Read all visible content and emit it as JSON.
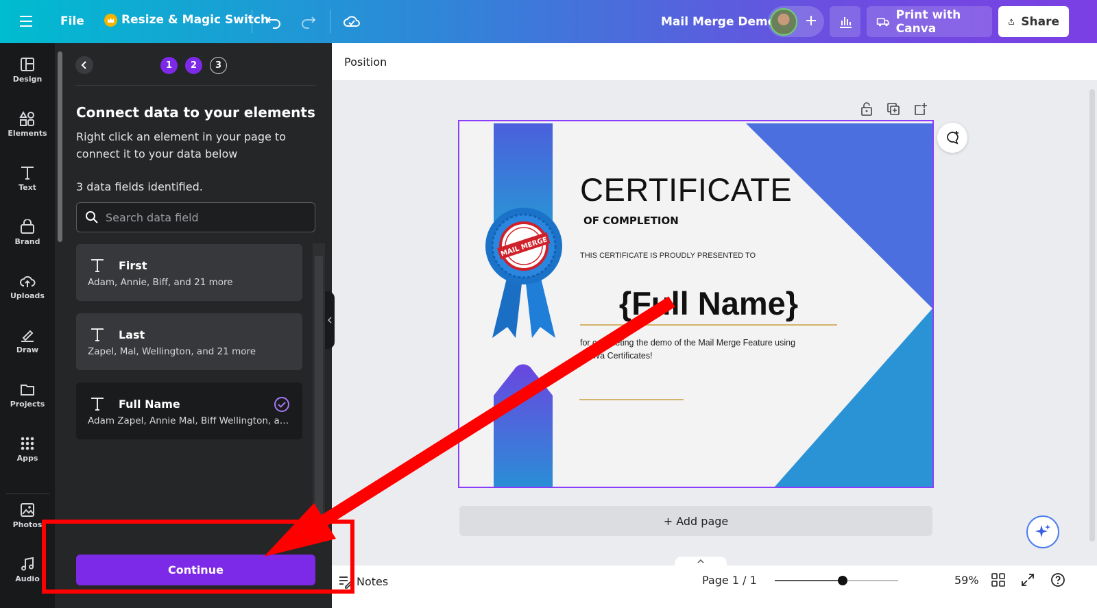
{
  "topbar": {
    "file_label": "File",
    "resize_label": "Resize & Magic Switch",
    "doc_title": "Mail Merge Demo",
    "print_label": "Print with Canva",
    "share_label": "Share"
  },
  "rail": {
    "items": [
      {
        "label": "Design"
      },
      {
        "label": "Elements"
      },
      {
        "label": "Text"
      },
      {
        "label": "Brand"
      },
      {
        "label": "Uploads"
      },
      {
        "label": "Draw"
      },
      {
        "label": "Projects"
      },
      {
        "label": "Apps"
      },
      {
        "label": "Photos"
      },
      {
        "label": "Audio"
      }
    ]
  },
  "panel": {
    "steps": [
      "1",
      "2",
      "3"
    ],
    "title": "Connect data to your elements",
    "description": "Right click an element in your page to connect it to your data below",
    "count": "3 data fields identified.",
    "search_placeholder": "Search data field",
    "fields": [
      {
        "name": "First",
        "values": "Adam, Annie, Biff, and 21 more"
      },
      {
        "name": "Last",
        "values": "Zapel, Mal, Wellington, and 21 more"
      },
      {
        "name": "Full Name",
        "values": "Adam Zapel, Annie Mal, Biff Wellington, and ..."
      }
    ],
    "continue_label": "Continue"
  },
  "canvas": {
    "subbar_label": "Position",
    "certificate": {
      "title": "CERTIFICATE",
      "subtitle": "OF COMPLETION",
      "presented": "THIS CERTIFICATE IS PROUDLY PRESENTED TO",
      "name_placeholder": "{Full Name}",
      "body": "for completing the demo of the Mail Merge Feature using Canva Certificates!",
      "seal_text": "MAIL MERGE"
    },
    "add_page_label": "+ Add page"
  },
  "bottombar": {
    "notes_label": "Notes",
    "page_info": "Page 1 / 1",
    "zoom_label": "59%",
    "zoom_fraction": 0.55
  },
  "colors": {
    "accent": "#7d2ae8",
    "annotation": "#ff0000",
    "cert_blue": "#4c6fe0",
    "cert_light_blue": "#2a93d5"
  }
}
